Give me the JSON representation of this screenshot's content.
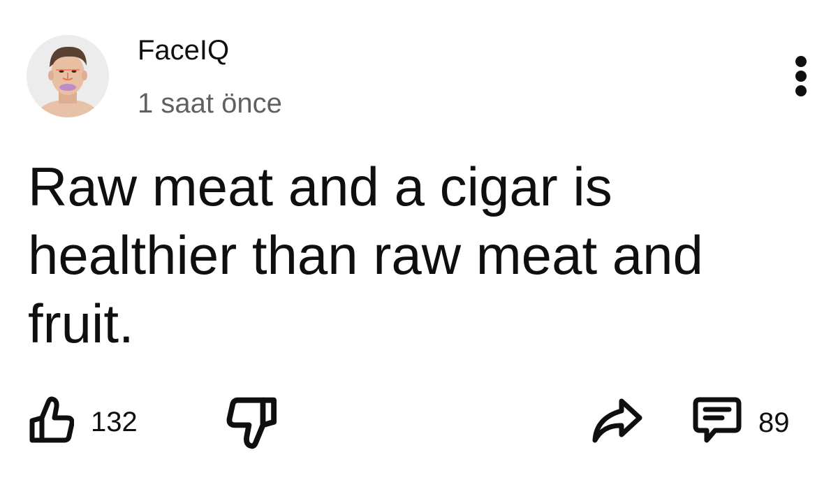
{
  "post": {
    "author": "FaceIQ",
    "timestamp": "1 saat önce",
    "text": "Raw meat and a cigar is healthier than raw meat and fruit."
  },
  "actions": {
    "like_icon": "thumbs-up-icon",
    "like_count": "132",
    "dislike_icon": "thumbs-down-icon",
    "share_icon": "share-arrow-icon",
    "comment_icon": "comment-bubble-icon",
    "comment_count": "89"
  },
  "menu": {
    "icon": "more-vertical-icon"
  },
  "colors": {
    "primary_text": "#0f0f0f",
    "secondary_text": "#606060",
    "background": "#ffffff"
  }
}
